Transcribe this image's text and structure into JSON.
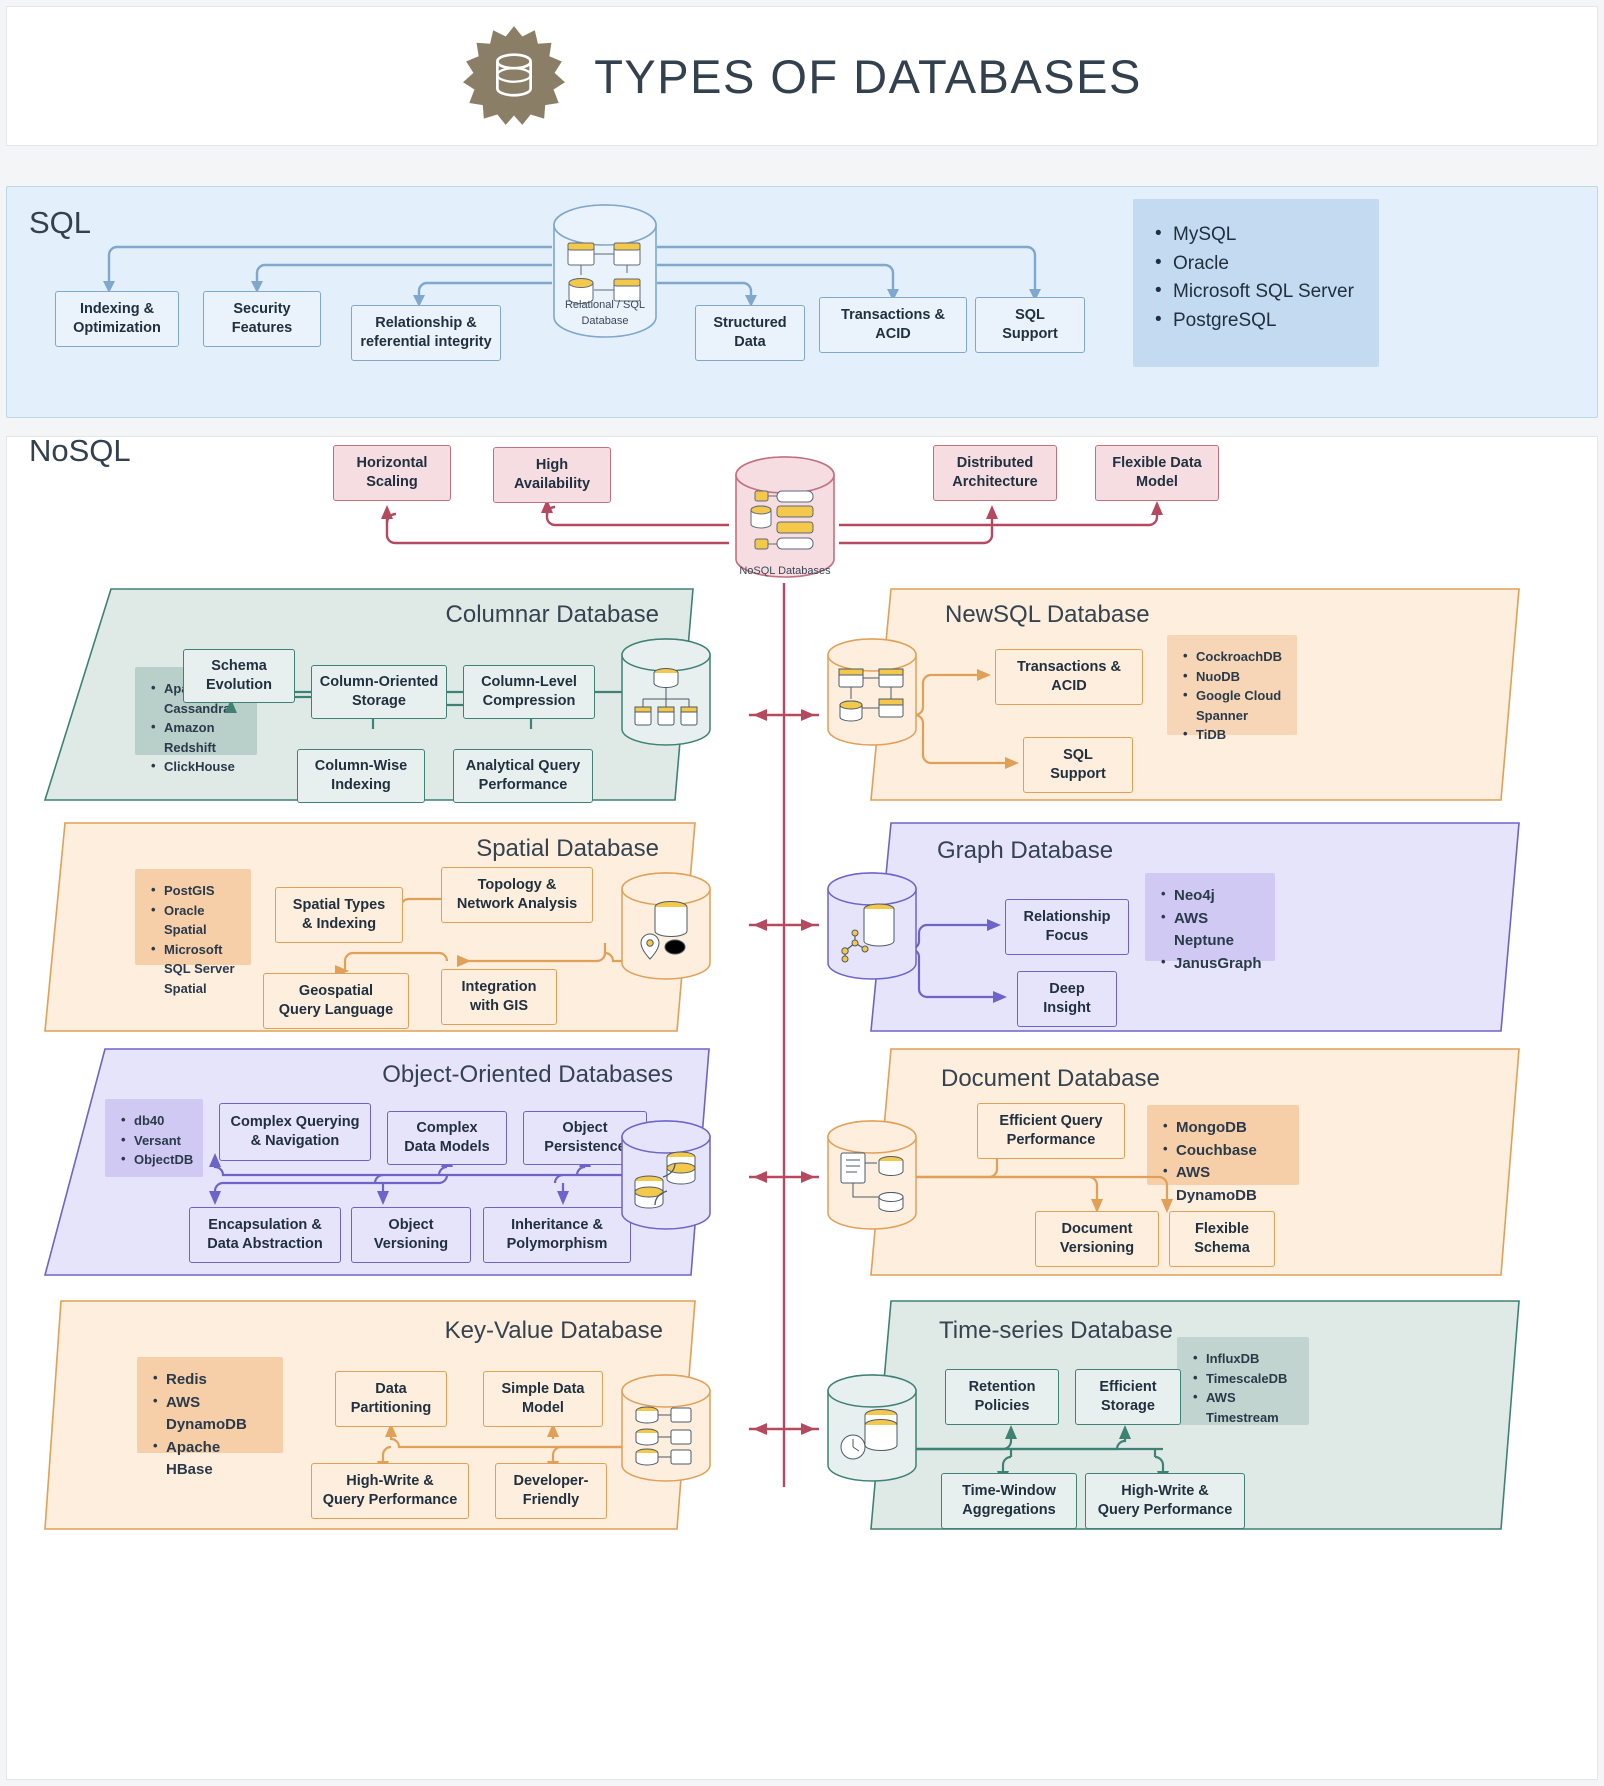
{
  "header": {
    "title": "TYPES OF DATABASES",
    "logo_icon": "database-badge-icon"
  },
  "sql": {
    "band_title": "SQL",
    "center_label_line1": "Relational / SQL",
    "center_label_line2": "Database",
    "nodes": [
      "Indexing & Optimization",
      "Security Features",
      "Relationship & referential integrity",
      "Structured Data",
      "Transactions & ACID",
      "SQL Support"
    ],
    "node_lines": [
      [
        "Indexing &",
        "Optimization"
      ],
      [
        "Security",
        "Features"
      ],
      [
        "Relationship &",
        "referential integrity"
      ],
      [
        "Structured",
        "Data"
      ],
      [
        "Transactions &",
        "ACID"
      ],
      [
        "SQL",
        "Support"
      ]
    ],
    "examples": [
      "MySQL",
      "Oracle",
      "Microsoft SQL Server",
      "PostgreSQL"
    ]
  },
  "nosql": {
    "band_title": "NoSQL",
    "center_label": "NoSQL Databases",
    "top_nodes": [
      [
        "Horizontal",
        "Scaling"
      ],
      [
        "High",
        "Availability"
      ],
      [
        "Distributed",
        "Architecture"
      ],
      [
        "Flexible Data",
        "Model"
      ]
    ]
  },
  "panels": {
    "columnar": {
      "title": "Columnar Database",
      "examples": [
        "Apache Cassandra",
        "Amazon Redshift",
        "ClickHouse"
      ],
      "nodes": [
        [
          "Schema",
          "Evolution"
        ],
        [
          "Column-Oriented",
          "Storage"
        ],
        [
          "Column-Level",
          "Compression"
        ],
        [
          "Column-Wise",
          "Indexing"
        ],
        [
          "Analytical Query",
          "Performance"
        ]
      ]
    },
    "newsql": {
      "title": "NewSQL Database",
      "examples": [
        "CockroachDB",
        "NuoDB",
        "Google Cloud Spanner",
        "TiDB"
      ],
      "nodes": [
        [
          "Transactions &",
          "ACID"
        ],
        [
          "SQL",
          "Support"
        ]
      ]
    },
    "spatial": {
      "title": "Spatial Database",
      "examples": [
        "PostGIS",
        "Oracle Spatial",
        "Microsoft SQL Server Spatial"
      ],
      "nodes": [
        [
          "Spatial Types",
          "& Indexing"
        ],
        [
          "Topology &",
          "Network Analysis"
        ],
        [
          "Geospatial",
          "Query Language"
        ],
        [
          "Integration",
          "with GIS"
        ]
      ]
    },
    "graph": {
      "title": "Graph Database",
      "examples": [
        "Neo4j",
        "AWS Neptune",
        "JanusGraph"
      ],
      "nodes": [
        [
          "Relationship",
          "Focus"
        ],
        [
          "Deep",
          "Insight"
        ]
      ]
    },
    "objectoriented": {
      "title": "Object-Oriented Databases",
      "examples": [
        "db40",
        "Versant",
        "ObjectDB"
      ],
      "nodes": [
        [
          "Complex Querying",
          "& Navigation"
        ],
        [
          "Complex",
          "Data Models"
        ],
        [
          "Object",
          "Persistence"
        ],
        [
          "Encapsulation &",
          "Data Abstraction"
        ],
        [
          "Object",
          "Versioning"
        ],
        [
          "Inheritance &",
          "Polymorphism"
        ]
      ]
    },
    "document": {
      "title": "Document Database",
      "examples": [
        "MongoDB",
        "Couchbase",
        "AWS DynamoDB"
      ],
      "nodes": [
        [
          "Efficient Query",
          "Performance"
        ],
        [
          "Document",
          "Versioning"
        ],
        [
          "Flexible",
          "Schema"
        ]
      ]
    },
    "keyvalue": {
      "title": "Key-Value Database",
      "examples": [
        "Redis",
        "AWS DynamoDB",
        "Apache HBase"
      ],
      "nodes": [
        [
          "Data",
          "Partitioning"
        ],
        [
          "Simple Data",
          "Model"
        ],
        [
          "High-Write &",
          "Query Performance"
        ],
        [
          "Developer-",
          "Friendly"
        ]
      ]
    },
    "timeseries": {
      "title": "Time-series Database",
      "examples": [
        "InfluxDB",
        "TimescaleDB",
        "AWS Timestream"
      ],
      "nodes": [
        [
          "Retention",
          "Policies"
        ],
        [
          "Efficient",
          "Storage"
        ],
        [
          "Time-Window",
          "Aggregations"
        ],
        [
          "High-Write &",
          "Query Performance"
        ]
      ]
    }
  },
  "colors": {
    "sql_blue": "#7fa8cc",
    "nosql_pink": "#b5495f",
    "teal": "#3f8274",
    "orange": "#e0a057",
    "purple": "#6e63c9",
    "title_ink": "#33414f"
  }
}
